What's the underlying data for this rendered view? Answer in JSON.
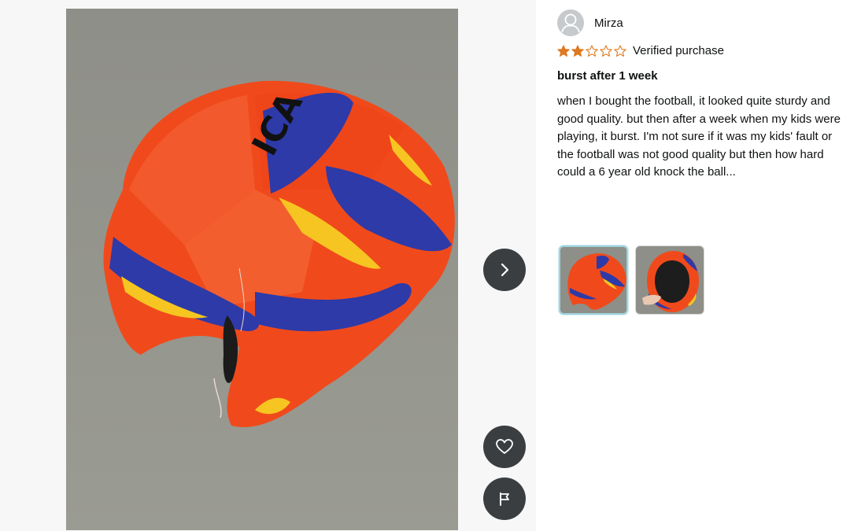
{
  "viewer": {
    "next_icon": "chevron-right-icon",
    "like_icon": "heart-icon",
    "report_icon": "flag-icon",
    "accent_color": "#3b3e40"
  },
  "review": {
    "author": "Mirza",
    "avatar_icon": "user-silhouette-icon",
    "rating": 2,
    "rating_max": 5,
    "star_color": "#de7921",
    "verified_label": "Verified purchase",
    "title": "burst after 1 week",
    "body_lines": [
      "when I bought the football, it looked quite sturdy and",
      "good quality. but then after a week when my kids were",
      "playing, it burst. I'm not sure if it was my kids' fault or",
      "the football was not good quality but then how hard",
      "could a 6 year old knock the ball..."
    ],
    "thumbnails": [
      {
        "label": "photo 1",
        "selected": true
      },
      {
        "label": "photo 2",
        "selected": false
      }
    ]
  }
}
